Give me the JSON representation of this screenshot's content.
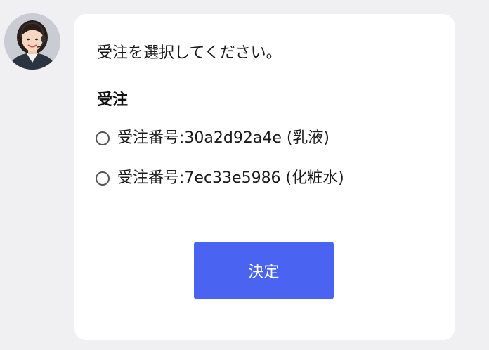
{
  "chat": {
    "avatar_icon": "operator-avatar",
    "message": "受注を選択してください。",
    "section_title": "受注",
    "options": [
      {
        "label": "受注番号:30a2d92a4e (乳液)",
        "selected": false
      },
      {
        "label": "受注番号:7ec33e5986 (化粧水)",
        "selected": false
      }
    ],
    "submit_label": "決定"
  },
  "colors": {
    "page_background": "#f0f0f3",
    "bubble_background": "#ffffff",
    "accent": "#4a63f0",
    "radio_border": "#555555"
  }
}
